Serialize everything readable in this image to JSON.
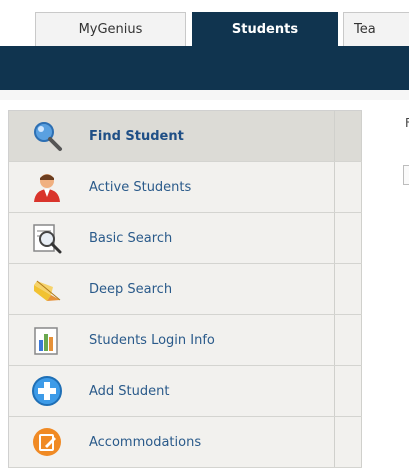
{
  "tabs": [
    {
      "label": "MyGenius",
      "active": false
    },
    {
      "label": "Students",
      "active": true
    },
    {
      "label": "Tea",
      "active": false
    }
  ],
  "menu": {
    "items": [
      {
        "label": "Find Student",
        "icon": "magnifier-icon",
        "active": true
      },
      {
        "label": "Active Students",
        "icon": "user-icon",
        "active": false
      },
      {
        "label": "Basic Search",
        "icon": "document-search-icon",
        "active": false
      },
      {
        "label": "Deep Search",
        "icon": "pencil-search-icon",
        "active": false
      },
      {
        "label": "Students Login Info",
        "icon": "chart-book-icon",
        "active": false
      },
      {
        "label": "Add Student",
        "icon": "plus-circle-icon",
        "active": false
      },
      {
        "label": "Accommodations",
        "icon": "edit-badge-icon",
        "active": false
      }
    ]
  },
  "content": {
    "partial_label": "F"
  },
  "colors": {
    "nav_bg": "#10344f",
    "menu_bg": "#f2f1ee",
    "menu_active_bg": "#dcdbd6",
    "link": "#2a5a8a"
  }
}
